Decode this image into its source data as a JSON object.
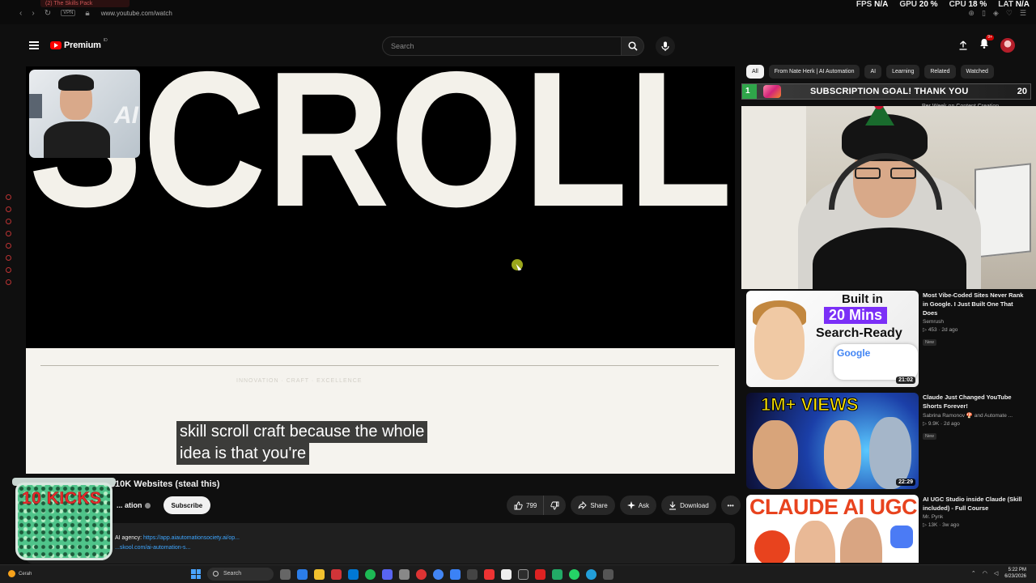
{
  "browser": {
    "tab_title": "(2) The Skills Pack",
    "url": "www.youtube.com/watch",
    "stats": [
      {
        "label": "FPS",
        "value": "N/A"
      },
      {
        "label": "GPU",
        "value": "20 %"
      },
      {
        "label": "CPU",
        "value": "18 %"
      },
      {
        "label": "LAT",
        "value": "N/A"
      }
    ]
  },
  "header": {
    "brand": "Premium",
    "region": "ID",
    "search_placeholder": "Search",
    "notification_count": "9+"
  },
  "player": {
    "headline": "SCROLL",
    "facecam_overlay_text": "AI",
    "caption_lines": [
      "skill scroll craft because the whole",
      "idea is that you're"
    ],
    "faint_text": "INNOVATION · CRAFT · EXCELLENCE"
  },
  "video": {
    "title": "This ... Skills Prints $10K Websites (steal this)",
    "channel": "... ation",
    "subscribe_label": "Subscribe",
    "like_count": "799",
    "share_label": "Share",
    "ask_label": "Ask",
    "download_label": "Download",
    "desc_line1_prefix": "AI agency:",
    "desc_line1_link": "https://app.aiautomationsociety.ai/op...",
    "desc_line2": "...skool.com/ai-automation-s..."
  },
  "overlay": {
    "jar_label": "10 KICKS"
  },
  "chips": [
    "All",
    "From Nate Herk | AI Automation",
    "AI",
    "Learning",
    "Related",
    "Watched"
  ],
  "goal": {
    "start": "1",
    "text": "SUBSCRIPTION GOAL! THANK YOU",
    "end": "20",
    "progress": 0.05,
    "ghost_text": "...Claude & Blotato to Save 15+ Hours Per Week on Content Creation"
  },
  "recommendations": [
    {
      "title": "Most Vibe-Coded Sites Never Rank in Google. I Just Built One That Does",
      "channel": "Semrush",
      "meta": "453 · 2d ago",
      "badge": "New",
      "duration": "21:02",
      "thumb_line1": "Built in",
      "thumb_line2": "20 Mins",
      "thumb_line3": "Search-Ready",
      "thumb_google": "Google"
    },
    {
      "title": "Claude Just Changed YouTube Shorts Forever!",
      "channel": "Sabrina Ramonov 🍄 and Automate ...",
      "meta": "9.9K · 2d ago",
      "badge": "New",
      "duration": "22:29",
      "thumb_line1": "1M+ VIEWS"
    },
    {
      "title": "AI UGC Studio inside Claude (Skill included) - Full Course",
      "channel": "Mr. Pynk",
      "meta": "13K · 3w ago",
      "badge": "",
      "duration": "",
      "thumb_line1": "CLAUDE AI UGC"
    }
  ],
  "taskbar": {
    "weather": "Cerah",
    "search_label": "Search",
    "time": "5:22 PM",
    "date": "6/23/2026"
  }
}
